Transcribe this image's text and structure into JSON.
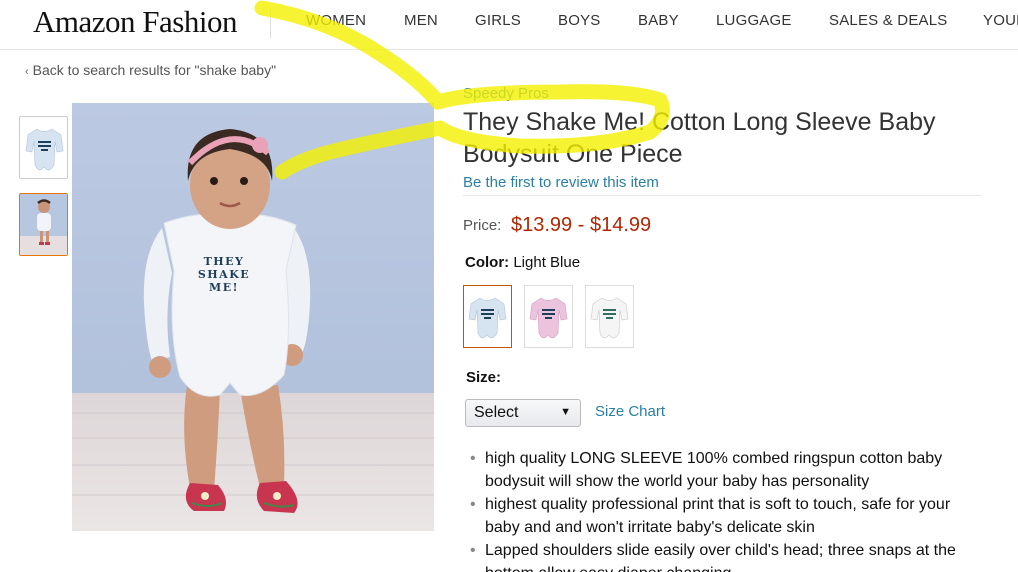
{
  "header": {
    "logo": "Amazon Fashion",
    "nav": [
      "WOMEN",
      "MEN",
      "GIRLS",
      "BOYS",
      "BABY",
      "LUGGAGE",
      "SALES & DEALS",
      "YOUR"
    ]
  },
  "breadcrumb": {
    "back_text": "Back to search results for \"shake baby\""
  },
  "product": {
    "brand": "Speedy Pros",
    "title": "They Shake Me! Cotton Long Sleeve Baby Bodysuit One Piece",
    "review_link": "Be the first to review this item",
    "price_label": "Price:",
    "price_value": "$13.99 - $14.99",
    "color_label": "Color:",
    "color_value": "Light Blue",
    "swatches": [
      "Light Blue",
      "Pink",
      "White"
    ],
    "size_label": "Size:",
    "size_select": "Select",
    "size_chart": "Size Chart",
    "shirt_print": "THEY SHAKE ME!",
    "bullets": [
      "high quality LONG SLEEVE 100% combed ringspun cotton baby bodysuit will show the world your baby has personality",
      "highest quality professional print that is soft to touch, safe for your baby and and won't irritate baby's delicate skin",
      "Lapped shoulders slide easily over child's head; three snaps at the bottom allow easy diaper changing"
    ]
  },
  "colors": {
    "link": "#2a7fa6",
    "price": "#b12704",
    "selected_border": "#c45500",
    "highlighter": "#f4f000",
    "photo_wall": "#b8c7e0",
    "photo_floor": "#e6dfe0",
    "onesie_blue": "#d6e3f1",
    "onesie_pink": "#ecc3dd",
    "onesie_white": "#f5f5f5",
    "print_text": "#1e3f58"
  },
  "icons": {
    "back": "chevron-left-icon",
    "select": "caret-down-icon"
  }
}
